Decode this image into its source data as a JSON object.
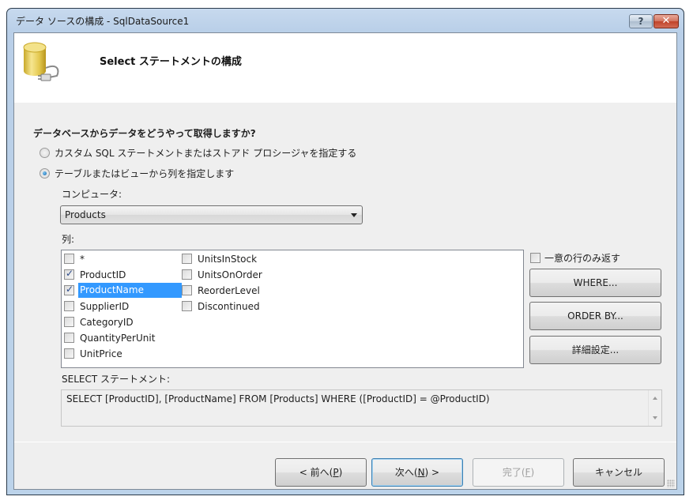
{
  "window": {
    "title": "データ ソースの構成 - SqlDataSource1",
    "help_label": "?",
    "close_label": "✕"
  },
  "header": {
    "title": "Select ステートメントの構成",
    "icon": "database-plug-icon"
  },
  "question": "データベースからデータをどうやって取得しますか?",
  "options": [
    {
      "label": "カスタム SQL ステートメントまたはストアド プロシージャを指定する",
      "checked": false
    },
    {
      "label": "テーブルまたはビューから列を指定します",
      "checked": true
    }
  ],
  "table_label": "コンピュータ:",
  "table_select": {
    "value": "Products"
  },
  "columns_label": "列:",
  "columns": [
    {
      "name": "*",
      "checked": false,
      "selected": false
    },
    {
      "name": "ProductID",
      "checked": true,
      "selected": false
    },
    {
      "name": "ProductName",
      "checked": true,
      "selected": true
    },
    {
      "name": "SupplierID",
      "checked": false,
      "selected": false
    },
    {
      "name": "CategoryID",
      "checked": false,
      "selected": false
    },
    {
      "name": "QuantityPerUnit",
      "checked": false,
      "selected": false
    },
    {
      "name": "UnitPrice",
      "checked": false,
      "selected": false
    },
    {
      "name": "UnitsInStock",
      "checked": false,
      "selected": false
    },
    {
      "name": "UnitsOnOrder",
      "checked": false,
      "selected": false
    },
    {
      "name": "ReorderLevel",
      "checked": false,
      "selected": false
    },
    {
      "name": "Discontinued",
      "checked": false,
      "selected": false
    }
  ],
  "distinct": {
    "label": "一意の行のみ返す",
    "checked": false
  },
  "side_buttons": {
    "where": "WHERE...",
    "order_by": "ORDER BY...",
    "advanced": "詳細設定..."
  },
  "statement_label": "SELECT ステートメント:",
  "statement": "SELECT [ProductID], [ProductName] FROM [Products] WHERE ([ProductID] = @ProductID)",
  "nav": {
    "prev": {
      "pre": "< 前へ(",
      "key": "P",
      "post": ")"
    },
    "next": {
      "pre": "次へ(",
      "key": "N",
      "post": ") >"
    },
    "finish": {
      "pre": "完了(",
      "key": "F",
      "post": ")",
      "disabled": true
    },
    "cancel": "キャンセル"
  }
}
